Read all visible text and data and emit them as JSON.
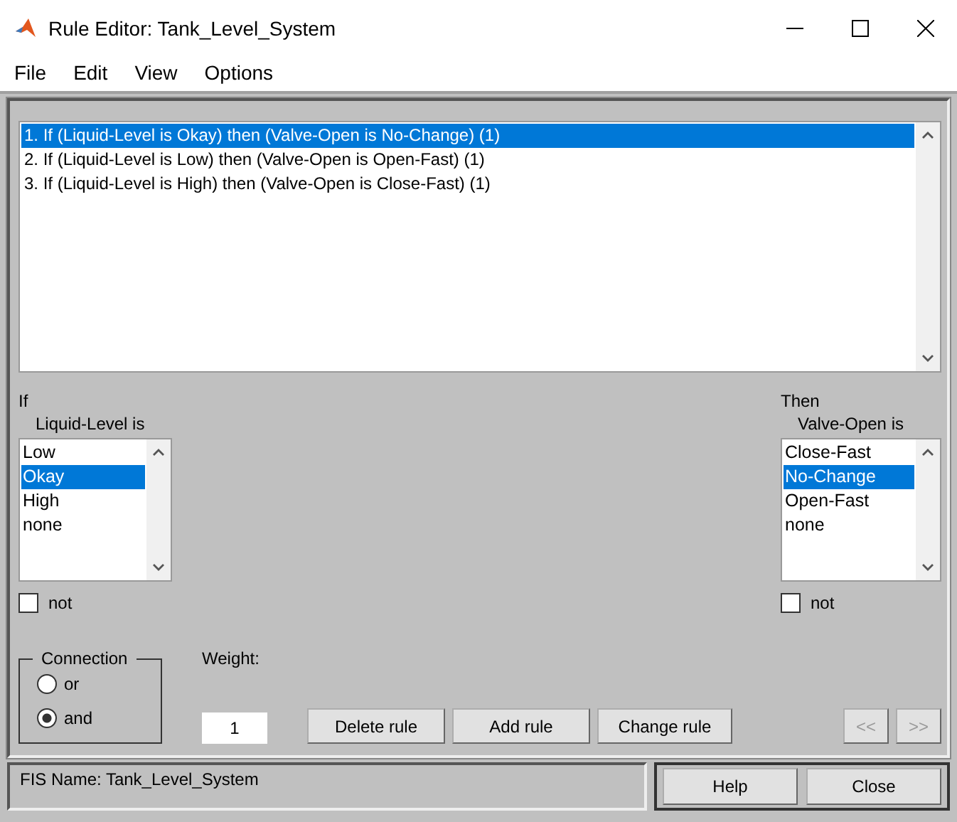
{
  "window": {
    "title": "Rule Editor: Tank_Level_System"
  },
  "menu": [
    "File",
    "Edit",
    "View",
    "Options"
  ],
  "rules": [
    {
      "text": "1. If (Liquid-Level is Okay) then (Valve-Open is No-Change) (1)",
      "selected": true
    },
    {
      "text": "2. If (Liquid-Level is Low) then (Valve-Open is Open-Fast) (1)",
      "selected": false
    },
    {
      "text": "3. If (Liquid-Level is High) then (Valve-Open is Close-Fast) (1)",
      "selected": false
    }
  ],
  "input": {
    "heading": "If",
    "variable": "Liquid-Level is",
    "options": [
      {
        "label": "Low",
        "selected": false
      },
      {
        "label": "Okay",
        "selected": true
      },
      {
        "label": "High",
        "selected": false
      },
      {
        "label": "none",
        "selected": false
      }
    ],
    "not_label": "not",
    "not_checked": false
  },
  "output": {
    "heading": "Then",
    "variable": "Valve-Open is",
    "options": [
      {
        "label": "Close-Fast",
        "selected": false
      },
      {
        "label": "No-Change",
        "selected": true
      },
      {
        "label": "Open-Fast",
        "selected": false
      },
      {
        "label": "none",
        "selected": false
      }
    ],
    "not_label": "not",
    "not_checked": false
  },
  "connection": {
    "label": "Connection",
    "options": [
      {
        "label": "or",
        "selected": false
      },
      {
        "label": "and",
        "selected": true
      }
    ]
  },
  "weight": {
    "label": "Weight:",
    "value": "1"
  },
  "actions": [
    "Delete rule",
    "Add rule",
    "Change rule"
  ],
  "nav": [
    {
      "label": "<<",
      "disabled": true
    },
    {
      "label": ">>",
      "disabled": true
    }
  ],
  "status": "FIS Name: Tank_Level_System",
  "footer_buttons": [
    "Help",
    "Close"
  ]
}
